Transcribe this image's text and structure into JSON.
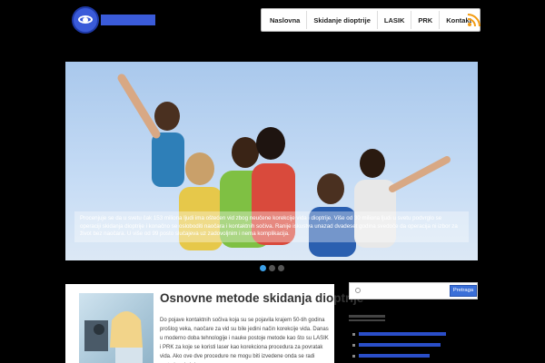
{
  "nav": {
    "items": [
      "Naslovna",
      "Skidanje dioptrije",
      "LASIK",
      "PRK",
      "Kontakt"
    ]
  },
  "slider": {
    "caption": "Procenjuje se da u svetu čak 153 miliona ljudi ima oštećen vid zbog neučene korekcije vida i dioptrije. Više od 30 miliona ljudi u svetu podvrglo se operaciji skidanja dioptrije i konačno se osloboditi naočara i kontaktnih sočiva. Ranije iskustva unazad dvadeset godina svedoče da operacija ni izbor za život bez naočara. U više od 99 posto slučajeva uz zadovoljnim i nema komplikacija."
  },
  "article": {
    "title": "Osnovne metode skidanja dioptrije",
    "body": "Do pojave kontaktnih sočiva koja su se pojavila krajem 50-tih godina prošlog veka, naočare za vid su bile jedini način korekcije vida. Danas u moderno doba tehnologije i nauke postoje metode kao što su LASIK i PRK za koje se koristi laser kao korekciona procedura za povratak vida. Ako ove dve procedure ne mogu biti izvedene onda se radi metoda u kojoj"
  },
  "search": {
    "placeholder": "",
    "button": "Pretraga"
  },
  "colors": {
    "accent": "#3a5bd9",
    "link": "#2a4ec8",
    "rss": "#f39c12"
  }
}
